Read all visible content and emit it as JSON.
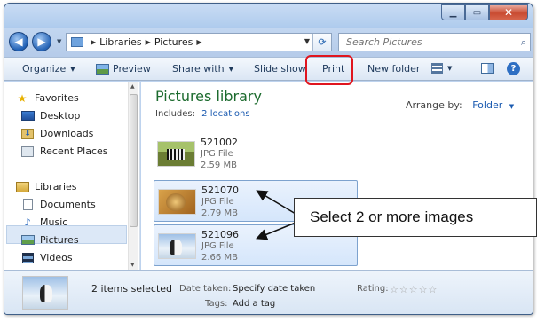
{
  "window": {
    "buttons": {
      "minimize": "▁",
      "maximize": "▭",
      "close": "✕"
    }
  },
  "address": {
    "back_icon": "back-arrow-icon",
    "forward_icon": "forward-arrow-icon",
    "crumbs": [
      "Libraries",
      "Pictures"
    ],
    "search_placeholder": "Search Pictures"
  },
  "toolbar": {
    "organize": "Organize",
    "preview": "Preview",
    "share_with": "Share with",
    "slide_show": "Slide show",
    "print": "Print",
    "new_folder": "New folder",
    "help": "?"
  },
  "nav": {
    "favorites": "Favorites",
    "desktop": "Desktop",
    "downloads": "Downloads",
    "recent_places": "Recent Places",
    "libraries": "Libraries",
    "documents": "Documents",
    "music": "Music",
    "pictures": "Pictures",
    "videos": "Videos"
  },
  "content": {
    "title": "Pictures library",
    "includes_label": "Includes:",
    "includes_link": "2 locations",
    "arrange_label": "Arrange by:",
    "arrange_value": "Folder",
    "files": [
      {
        "name": "521002",
        "type": "JPG File",
        "size": "2.59 MB",
        "selected": false
      },
      {
        "name": "521070",
        "type": "JPG File",
        "size": "2.79 MB",
        "selected": true
      },
      {
        "name": "521096",
        "type": "JPG File",
        "size": "2.66 MB",
        "selected": true
      }
    ]
  },
  "callout": "Select 2 or more images",
  "details": {
    "count": "2 items selected",
    "date_label": "Date taken:",
    "date_value": "Specify date taken",
    "tags_label": "Tags:",
    "tags_value": "Add a tag",
    "rating_label": "Rating:",
    "rating_stars": 0
  },
  "colors": {
    "accent_red": "#e0151e",
    "library_title": "#1c6b2e",
    "link": "#1a5ab0",
    "selection": "#d5e6fb"
  }
}
